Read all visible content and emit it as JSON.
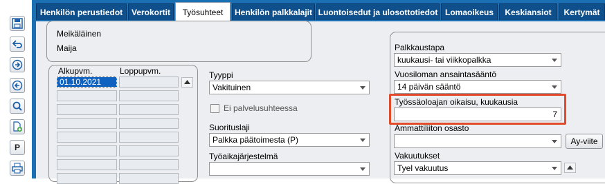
{
  "tabs": [
    {
      "label": "Henkilön perustiedot",
      "active": false
    },
    {
      "label": "Verokortit",
      "active": false
    },
    {
      "label": "Työsuhteet",
      "active": true
    },
    {
      "label": "Henkilön palkkalajit",
      "active": false
    },
    {
      "label": "Luontoisedut ja ulosottotiedot",
      "active": false
    },
    {
      "label": "Lomaoikeus",
      "active": false
    },
    {
      "label": "Keskiansiot",
      "active": false
    },
    {
      "label": "Kertymät",
      "active": false
    }
  ],
  "toolbar": {
    "icons": [
      "save-icon",
      "undo-icon",
      "next-icon",
      "previous-icon",
      "search-icon",
      "new-document-icon",
      "p-button",
      "print-icon"
    ],
    "p_label": "P"
  },
  "person": {
    "last_name": "Meikäläinen",
    "first_name": "Maija"
  },
  "employment_list": {
    "start_header": "Alkupvm.",
    "end_header": "Loppupvm.",
    "rows": [
      {
        "start": "01.10.2021",
        "end": ""
      }
    ]
  },
  "fields": {
    "type": {
      "label": "Tyyppi",
      "value": "Vakituinen"
    },
    "no_employment": {
      "label": "Ei palvelusuhteessa",
      "checked": false
    },
    "mode": {
      "label": "Suorituslaji",
      "value": "Palkka päätoimesta (P)"
    },
    "working_time": {
      "label": "Työaikajärjestelmä",
      "value": ""
    },
    "pay_method": {
      "label": "Palkkaustapa",
      "value": "kuukausi- tai viikkopalkka"
    },
    "holiday_rule": {
      "label": "Vuosiloman ansaintasääntö",
      "value": "14 päivän sääntö"
    },
    "employer_correction": {
      "label": "Työssäoloajan oikaisu, kuukausia",
      "value": "7"
    },
    "union_dept": {
      "label": "Ammattiliiton osasto",
      "value": ""
    },
    "union_button": "Ay-viite",
    "insurance": {
      "label": "Vakuutukset",
      "value": "Tyel vakuutus"
    }
  },
  "colors": {
    "tab_bar": "#1b6fb3",
    "tab": "#0e4f8c",
    "content_bg": "#eceef1",
    "highlight": "#e24a2a",
    "selected": "#0f62c0"
  }
}
